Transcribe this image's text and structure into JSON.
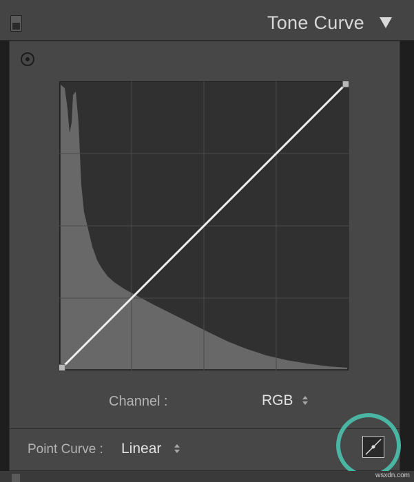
{
  "panel": {
    "title": "Tone Curve",
    "collapse_icon": "triangle-down-icon",
    "toggle_icon": "panel-switch-icon"
  },
  "curve": {
    "targeted_adjustment_icon": "target-circle-icon",
    "grid_divisions": 4,
    "endpoint_color": "#b8b8b8",
    "line_color": "#eeeeee",
    "histogram_color": "#6b6b6b",
    "background_color": "#303030",
    "points": [
      {
        "input": 0,
        "output": 0
      },
      {
        "input": 255,
        "output": 255
      }
    ]
  },
  "channel": {
    "label": "Channel :",
    "value": "RGB"
  },
  "point_curve": {
    "label": "Point Curve :",
    "value": "Linear",
    "edit_button_icon": "point-curve-edit-icon"
  },
  "highlight": {
    "color": "#49b5a2"
  },
  "watermark": "wsxdn.com"
}
